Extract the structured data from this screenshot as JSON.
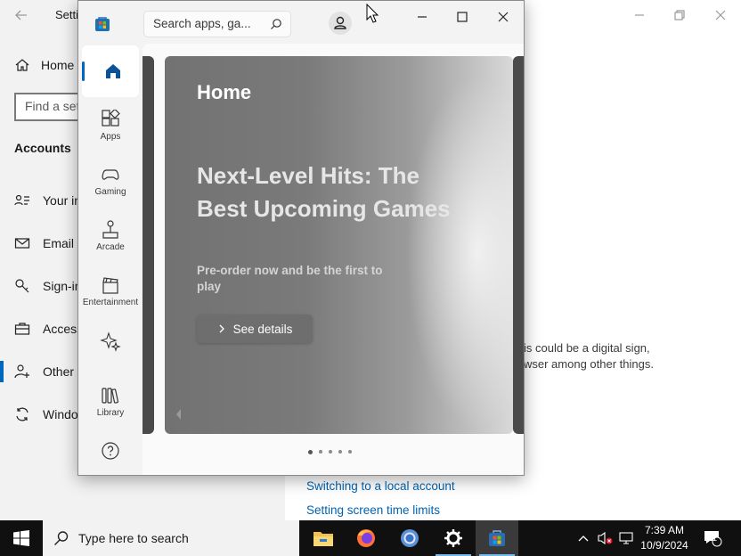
{
  "settings": {
    "title": "Setti",
    "home_label": "Home",
    "search_placeholder": "Find a set",
    "section_title": "Accounts",
    "nav_items": [
      {
        "label": "Your in",
        "icon": "person-card-icon"
      },
      {
        "label": "Email &",
        "icon": "mail-icon"
      },
      {
        "label": "Sign-in",
        "icon": "key-icon"
      },
      {
        "label": "Access",
        "icon": "briefcase-icon"
      },
      {
        "label": "Other",
        "icon": "person-add-icon"
      },
      {
        "label": "Windo",
        "icon": "sync-icon"
      }
    ],
    "body_line1": "is could be a digital sign,",
    "body_line2": "wser among other things.",
    "links": [
      "Switching to a local account",
      "Setting screen time limits"
    ],
    "accent_color": "#0067c0"
  },
  "store": {
    "search_placeholder": "Search apps, ga...",
    "sidebar": [
      {
        "label": "Apps",
        "icon": "apps-icon"
      },
      {
        "label": "Gaming",
        "icon": "gamepad-icon"
      },
      {
        "label": "Arcade",
        "icon": "joystick-icon"
      },
      {
        "label": "Entertainment",
        "icon": "clapperboard-icon"
      },
      {
        "label": "",
        "icon": "sparkle-icon"
      },
      {
        "label": "Library",
        "icon": "library-icon"
      },
      {
        "label": "",
        "icon": "help-icon"
      }
    ],
    "hero": {
      "heading": "Home",
      "title": "Next-Level Hits: The Best Upcoming Games",
      "subtitle": "Pre-order now and be the first to play",
      "button_label": "See details"
    },
    "carousel_pages": 5,
    "carousel_active": 1
  },
  "taskbar": {
    "search_placeholder": "Type here to search",
    "apps": [
      "file-explorer-icon",
      "firefox-icon",
      "chrome-icon",
      "settings-icon",
      "store-icon"
    ],
    "time": "7:39 AM",
    "date": "10/9/2024",
    "notification_count": "1"
  }
}
